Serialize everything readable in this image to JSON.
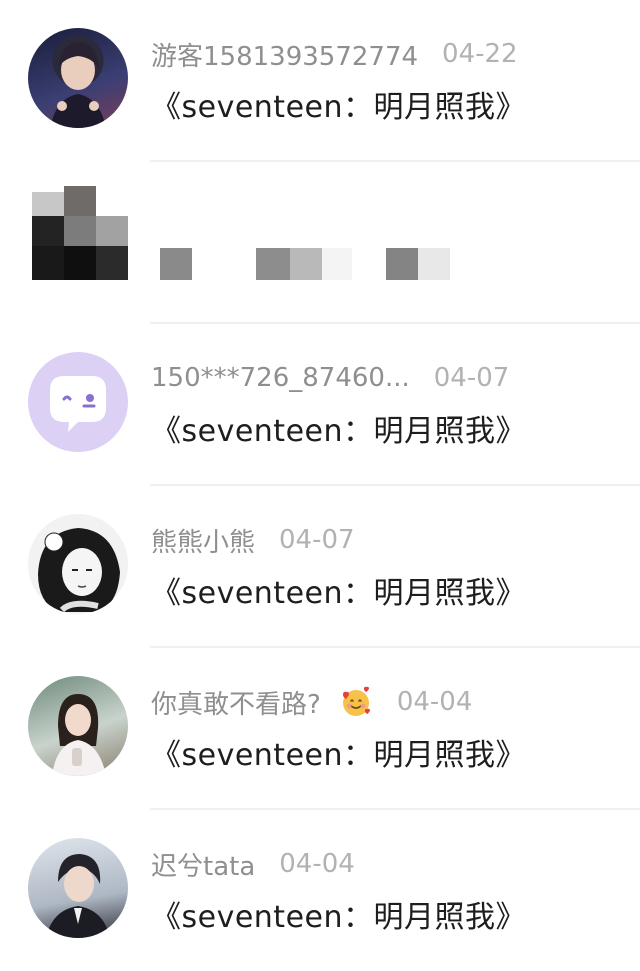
{
  "comments": [
    {
      "username": "游客1581393572774",
      "date": "04-22",
      "text": "《seventeen：明月照我》"
    },
    {
      "username": "",
      "date": "",
      "text": ""
    },
    {
      "username": "150***726_87460...",
      "date": "04-07",
      "text": "《seventeen：明月照我》"
    },
    {
      "username": "熊熊小熊",
      "date": "04-07",
      "text": "《seventeen：明月照我》"
    },
    {
      "username": "你真敢不看路?",
      "date": "04-04",
      "text": "《seventeen：明月照我》"
    },
    {
      "username": "迟兮tata",
      "date": "04-04",
      "text": "《seventeen：明月照我》"
    }
  ],
  "icons": {
    "default_avatar": "chat-bubble-icon",
    "emoji": "smiling-face-with-hearts-icon"
  },
  "colors": {
    "username": "#8f8f8f",
    "date": "#b2b2b2",
    "text": "#1e1e1e",
    "default_avatar_bg": "#dcd0f5",
    "default_avatar_fg": "#ffffff"
  }
}
